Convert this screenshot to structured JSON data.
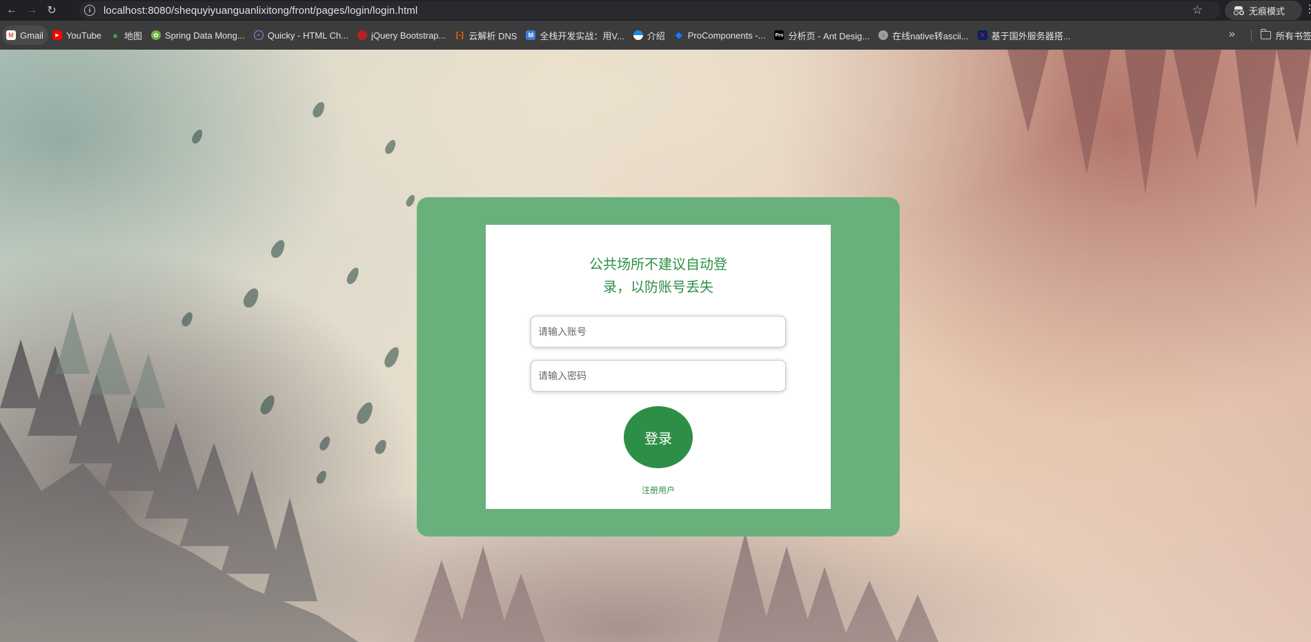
{
  "browser": {
    "url": "localhost:8080/shequyiyuanguanlixitong/front/pages/login/login.html",
    "incognito_label": "无痕模式",
    "bookmarks": [
      {
        "label": "Gmail",
        "icon": "gmail-icon",
        "color": "#ea4335"
      },
      {
        "label": "YouTube",
        "icon": "youtube-icon",
        "color": "#ff0000"
      },
      {
        "label": "地图",
        "icon": "maps-icon",
        "color": "#34a853"
      },
      {
        "label": "Spring Data Mong...",
        "icon": "spring-icon",
        "color": "#6db33f"
      },
      {
        "label": "Quicky - HTML Ch...",
        "icon": "quicky-icon",
        "color": "#5b5be6"
      },
      {
        "label": "jQuery Bootstrap...",
        "icon": "jquery-icon",
        "color": "#b22222"
      },
      {
        "label": "云解析 DNS",
        "icon": "aliyun-icon",
        "color": "#ff6a00"
      },
      {
        "label": "全栈开发实战：用V...",
        "icon": "m-icon",
        "color": "#3b7ddd"
      },
      {
        "label": "介绍",
        "icon": "intro-icon",
        "color": "#1e88e5"
      },
      {
        "label": "ProComponents -...",
        "icon": "procomponents-icon",
        "color": "#1677ff"
      },
      {
        "label": "分析页 - Ant Desig...",
        "icon": "pro-icon",
        "color": "#000000"
      },
      {
        "label": "在线native转ascii...",
        "icon": "globe-icon",
        "color": "#9aa0a6"
      },
      {
        "label": "基于国外服务器搭...",
        "icon": "flag-icon",
        "color": "#012169"
      }
    ],
    "all_bookmarks_label": "所有书签"
  },
  "login": {
    "tip": "公共场所不建议自动登录，以防账号丢失",
    "username_placeholder": "请输入账号",
    "password_placeholder": "请输入密码",
    "login_label": "登录",
    "register_label": "注册用户"
  },
  "colors": {
    "card": "#69b07d",
    "accent": "#2d8f47"
  }
}
